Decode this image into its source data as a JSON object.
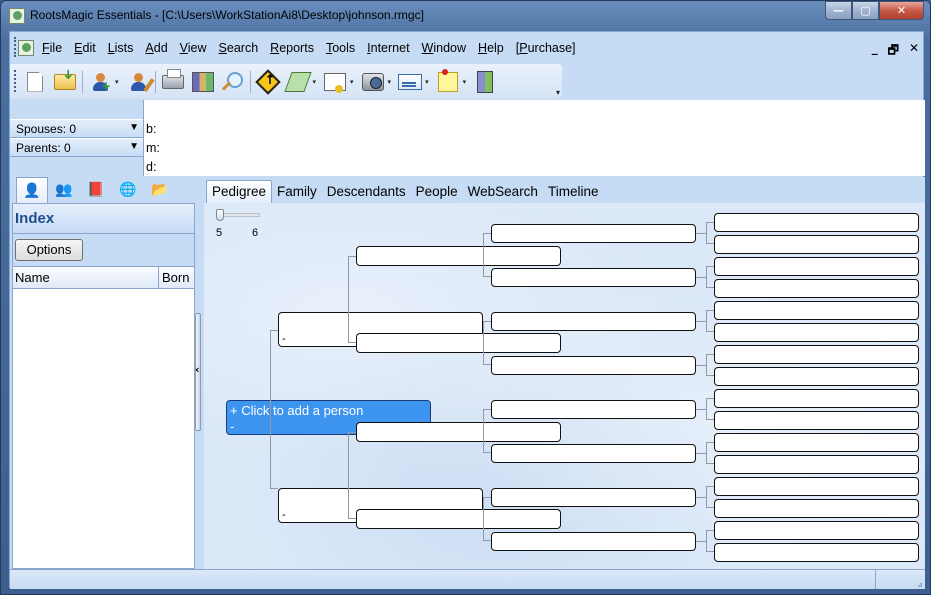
{
  "window": {
    "title": "RootsMagic Essentials - [C:\\Users\\WorkStationAi8\\Desktop\\johnson.rmgc]",
    "controls": {
      "minimize": "—",
      "maximize": "▢",
      "close": "✕"
    }
  },
  "menubar": {
    "items": [
      {
        "accel": "F",
        "rest": "ile"
      },
      {
        "accel": "E",
        "rest": "dit"
      },
      {
        "accel": "L",
        "rest": "ists"
      },
      {
        "accel": "A",
        "rest": "dd"
      },
      {
        "accel": "V",
        "rest": "iew"
      },
      {
        "accel": "S",
        "rest": "earch"
      },
      {
        "accel": "R",
        "rest": "eports"
      },
      {
        "accel": "T",
        "rest": "ools"
      },
      {
        "accel": "I",
        "rest": "nternet"
      },
      {
        "accel": "W",
        "rest": "indow"
      },
      {
        "accel": "H",
        "rest": "elp"
      },
      {
        "pre": "[",
        "accel": "P",
        "rest": "urchase]"
      }
    ],
    "mdi_controls": {
      "minimize": "_",
      "restore": "🗗",
      "close": "✕"
    }
  },
  "toolbar": {
    "buttons": [
      {
        "icon": "new-file-icon"
      },
      {
        "icon": "open-file-icon"
      },
      {
        "icon": "add-person-icon",
        "dropdown": true
      },
      {
        "icon": "edit-person-icon"
      },
      {
        "icon": "print-icon"
      },
      {
        "icon": "books-icon"
      },
      {
        "icon": "search-icon"
      },
      {
        "icon": "navigate-icon"
      },
      {
        "icon": "notebook-icon",
        "dropdown": true
      },
      {
        "icon": "certificate-icon",
        "dropdown": true
      },
      {
        "icon": "camera-icon",
        "dropdown": true
      },
      {
        "icon": "mail-icon",
        "dropdown": true
      },
      {
        "icon": "sticky-note-icon",
        "dropdown": true
      },
      {
        "icon": "exit-icon"
      }
    ],
    "dropdown_glyph": "▾",
    "overflow_glyph": "▾"
  },
  "family": {
    "spouses": "Spouses: 0",
    "parents": "Parents: 0",
    "arrow": "▼",
    "birth_label": "b:",
    "marriage_label": "m:",
    "death_label": "d:"
  },
  "left_panel": {
    "tabs": [
      {
        "icon": "person-icon",
        "glyph": "👤",
        "active": true
      },
      {
        "icon": "family-icon",
        "glyph": "👥"
      },
      {
        "icon": "sources-icon",
        "glyph": "📕"
      },
      {
        "icon": "places-icon",
        "glyph": "🌐"
      },
      {
        "icon": "groups-icon",
        "glyph": "📂"
      }
    ],
    "title": "Index",
    "options_label": "Options",
    "columns": [
      "Name",
      "Born"
    ],
    "rows": [],
    "collapse_glyph": "‹"
  },
  "main_tabs": {
    "items": [
      "Pedigree",
      "Family",
      "Descendants",
      "People",
      "WebSearch",
      "Timeline"
    ],
    "active": "Pedigree"
  },
  "pedigree": {
    "generations_slider": {
      "min_label": "5",
      "max_label": "6",
      "value": 5
    },
    "root_person": {
      "line1": "+ Click to add a person",
      "line2": "-"
    },
    "father_dash": "-",
    "mother_dash": "-"
  },
  "statusbar": {
    "text": "",
    "grip": "⣠"
  }
}
